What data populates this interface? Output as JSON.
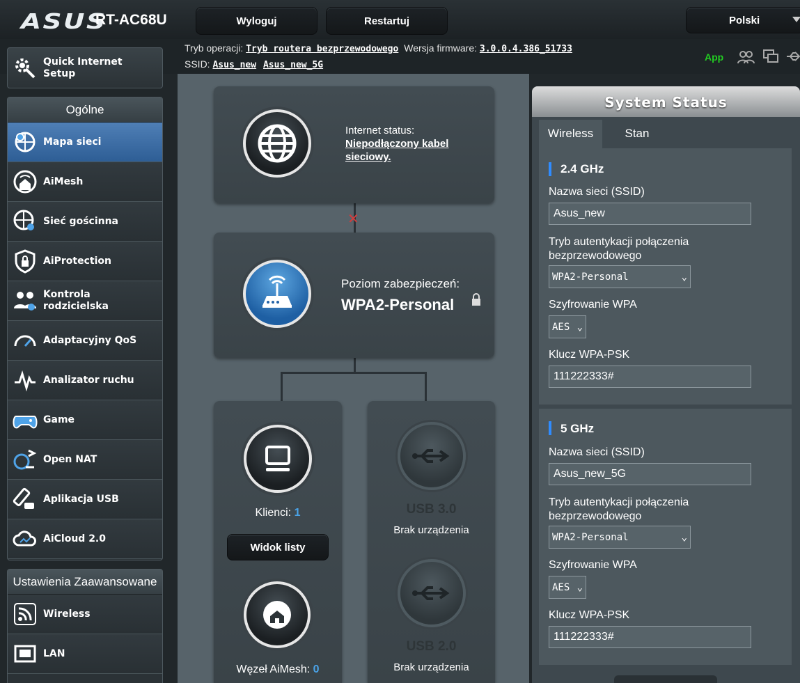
{
  "header": {
    "brand": "ASUS",
    "model": "RT-AC68U",
    "logout_label": "Wyloguj",
    "restart_label": "Restartuj",
    "language": "Polski",
    "mode_label": "Tryb operacji:",
    "mode_value": "Tryb routera bezprzewodowego",
    "firmware_label": "Wersja firmware:",
    "firmware_value": "3.0.0.4.386_51733",
    "ssid_label": "SSID:",
    "ssid_24": "Asus_new",
    "ssid_5": "Asus_new_5G",
    "app_label": "App"
  },
  "sidebar": {
    "quick_setup": "Quick Internet Setup",
    "general_heading": "Ogólne",
    "items": [
      {
        "label": "Mapa sieci",
        "icon": "network-map-icon",
        "active": true
      },
      {
        "label": "AiMesh",
        "icon": "aimesh-icon"
      },
      {
        "label": "Sieć gościnna",
        "icon": "guest-network-icon"
      },
      {
        "label": "AiProtection",
        "icon": "shield-lock-icon"
      },
      {
        "label": "Kontrola rodzicielska",
        "icon": "parental-control-icon"
      },
      {
        "label": "Adaptacyjny QoS",
        "icon": "gauge-icon"
      },
      {
        "label": "Analizator ruchu",
        "icon": "traffic-analyzer-icon"
      },
      {
        "label": "Game",
        "icon": "gamepad-icon"
      },
      {
        "label": "Open NAT",
        "icon": "open-nat-icon"
      },
      {
        "label": "Aplikacja USB",
        "icon": "usb-app-icon"
      },
      {
        "label": "AiCloud 2.0",
        "icon": "cloud-icon"
      }
    ],
    "advanced_heading": "Ustawienia Zaawansowane",
    "advanced_items": [
      {
        "label": "Wireless",
        "icon": "wifi-icon"
      },
      {
        "label": "LAN",
        "icon": "lan-icon"
      }
    ]
  },
  "map": {
    "internet_status_label": "Internet status:",
    "internet_status_value": "Niepodłączony kabel sieciowy.",
    "security_label": "Poziom zabezpieczeń:",
    "security_value": "WPA2-Personal",
    "clients_label": "Klienci:",
    "clients_count": "1",
    "list_view_label": "Widok listy",
    "aimesh_label": "Węzeł AiMesh:",
    "aimesh_count": "0",
    "usb3_label": "USB 3.0",
    "usb3_status": "Brak urządzenia",
    "usb2_label": "USB 2.0",
    "usb2_status": "Brak urządzenia"
  },
  "status": {
    "title": "System Status",
    "tabs": [
      "Wireless",
      "Stan"
    ],
    "band24": {
      "heading": "2.4 GHz",
      "ssid_label": "Nazwa sieci (SSID)",
      "ssid_value": "Asus_new",
      "auth_label": "Tryb autentykacji połączenia bezprzewodowego",
      "auth_value": "WPA2-Personal",
      "enc_label": "Szyfrowanie WPA",
      "enc_value": "AES",
      "key_label": "Klucz WPA-PSK",
      "key_value": "111222333#"
    },
    "band5": {
      "heading": "5 GHz",
      "ssid_label": "Nazwa sieci (SSID)",
      "ssid_value": "Asus_new_5G",
      "auth_label": "Tryb autentykacji połączenia bezprzewodowego",
      "auth_value": "WPA2-Personal",
      "enc_label": "Szyfrowanie WPA",
      "enc_value": "AES",
      "key_label": "Klucz WPA-PSK",
      "key_value": "111222333#"
    }
  },
  "colors": {
    "accent": "#2f8cff",
    "app_green": "#22cc22",
    "disconnected_red": "#d43c3c",
    "link_blue": "#4aa3e8"
  }
}
